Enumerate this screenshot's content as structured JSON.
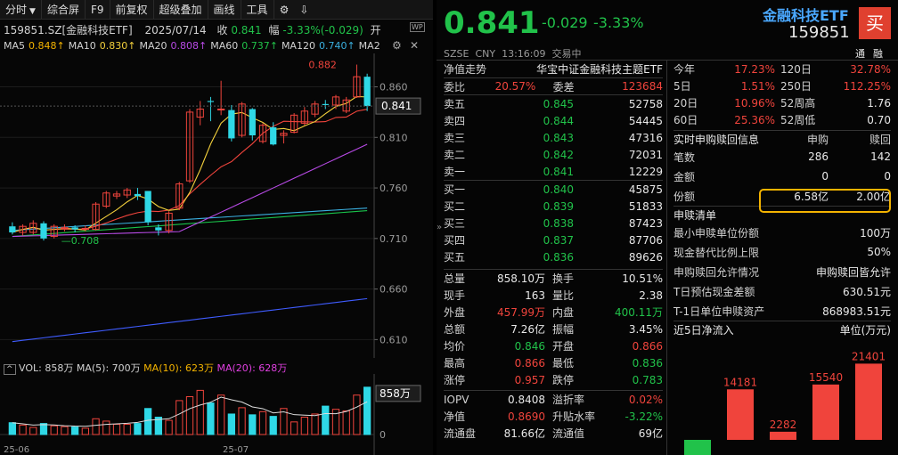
{
  "toolbar": {
    "period": "分时",
    "tabs": [
      "综合屏",
      "F9",
      "前复权",
      "超级叠加",
      "画线",
      "工具"
    ]
  },
  "info": {
    "code_name": "159851.SZ[金融科技ETF]",
    "date": "2025/07/14",
    "close_label": "收",
    "close": "0.841",
    "change_label": "幅",
    "change": "-3.33%(-0.029)",
    "open_label": "开"
  },
  "ma": {
    "ma5_label": "MA5",
    "ma5": "0.848↑",
    "ma10_label": "MA10",
    "ma10": "0.830↑",
    "ma20_label": "MA20",
    "ma20": "0.808↑",
    "ma60_label": "MA60",
    "ma60": "0.737↑",
    "ma120_label": "MA120",
    "ma120": "0.740↑",
    "ma2_label": "MA2"
  },
  "kline": {
    "max_label": "0.882",
    "min_label": "0.708",
    "price_axis": [
      "0.860",
      "0.810",
      "0.760",
      "0.710",
      "0.660",
      "0.610"
    ],
    "current": "0.841",
    "date_ticks": [
      "25-06",
      "25-07"
    ],
    "candles": [
      {
        "o": 0.722,
        "c": 0.716,
        "h": 0.726,
        "l": 0.714
      },
      {
        "o": 0.716,
        "c": 0.722,
        "h": 0.724,
        "l": 0.713
      },
      {
        "o": 0.716,
        "c": 0.725,
        "h": 0.728,
        "l": 0.714
      },
      {
        "o": 0.725,
        "c": 0.71,
        "h": 0.727,
        "l": 0.708
      },
      {
        "o": 0.712,
        "c": 0.722,
        "h": 0.724,
        "l": 0.71
      },
      {
        "o": 0.72,
        "c": 0.721,
        "h": 0.724,
        "l": 0.717
      },
      {
        "o": 0.721,
        "c": 0.719,
        "h": 0.723,
        "l": 0.716
      },
      {
        "o": 0.719,
        "c": 0.72,
        "h": 0.723,
        "l": 0.717
      },
      {
        "o": 0.719,
        "c": 0.744,
        "h": 0.746,
        "l": 0.718
      },
      {
        "o": 0.742,
        "c": 0.755,
        "h": 0.757,
        "l": 0.74
      },
      {
        "o": 0.752,
        "c": 0.754,
        "h": 0.757,
        "l": 0.749
      },
      {
        "o": 0.753,
        "c": 0.758,
        "h": 0.76,
        "l": 0.75
      },
      {
        "o": 0.754,
        "c": 0.752,
        "h": 0.76,
        "l": 0.748
      },
      {
        "o": 0.757,
        "c": 0.726,
        "h": 0.757,
        "l": 0.723
      },
      {
        "o": 0.721,
        "c": 0.718,
        "h": 0.724,
        "l": 0.713
      },
      {
        "o": 0.718,
        "c": 0.735,
        "h": 0.737,
        "l": 0.715
      },
      {
        "o": 0.74,
        "c": 0.764,
        "h": 0.766,
        "l": 0.738
      },
      {
        "o": 0.767,
        "c": 0.835,
        "h": 0.838,
        "l": 0.765
      },
      {
        "o": 0.83,
        "c": 0.838,
        "h": 0.846,
        "l": 0.822
      },
      {
        "o": 0.846,
        "c": 0.845,
        "h": 0.85,
        "l": 0.826
      },
      {
        "o": 0.838,
        "c": 0.838,
        "h": 0.866,
        "l": 0.832
      },
      {
        "o": 0.837,
        "c": 0.809,
        "h": 0.842,
        "l": 0.806
      },
      {
        "o": 0.812,
        "c": 0.843,
        "h": 0.845,
        "l": 0.81
      },
      {
        "o": 0.838,
        "c": 0.812,
        "h": 0.839,
        "l": 0.807
      },
      {
        "o": 0.806,
        "c": 0.822,
        "h": 0.824,
        "l": 0.804
      },
      {
        "o": 0.82,
        "c": 0.803,
        "h": 0.825,
        "l": 0.802
      },
      {
        "o": 0.812,
        "c": 0.814,
        "h": 0.817,
        "l": 0.804
      },
      {
        "o": 0.815,
        "c": 0.832,
        "h": 0.834,
        "l": 0.814
      },
      {
        "o": 0.824,
        "c": 0.836,
        "h": 0.84,
        "l": 0.822
      },
      {
        "o": 0.833,
        "c": 0.843,
        "h": 0.846,
        "l": 0.83
      },
      {
        "o": 0.843,
        "c": 0.842,
        "h": 0.847,
        "l": 0.838
      },
      {
        "o": 0.842,
        "c": 0.85,
        "h": 0.852,
        "l": 0.838
      },
      {
        "o": 0.836,
        "c": 0.847,
        "h": 0.85,
        "l": 0.834
      },
      {
        "o": 0.85,
        "c": 0.87,
        "h": 0.882,
        "l": 0.849
      },
      {
        "o": 0.87,
        "c": 0.841,
        "h": 0.873,
        "l": 0.836
      }
    ],
    "ma_lines": {
      "ma5_color": "#f3d03c",
      "ma10_color": "#f0443c",
      "ma20_color": "#b84ae6",
      "ma60_color": "#19c24a",
      "ma120_color": "#3ab0e0",
      "ma250_color": "#3f5cff"
    }
  },
  "vol": {
    "label": "VOL: 858万",
    "ma5": "MA(5): 700万",
    "ma10": "MA(10): 623万",
    "ma20": "MA(20): 628万",
    "current": "858万",
    "zero": "0",
    "bars": [
      150,
      120,
      90,
      140,
      110,
      100,
      95,
      80,
      200,
      170,
      130,
      130,
      140,
      330,
      220,
      180,
      430,
      480,
      560,
      400,
      500,
      260,
      340,
      250,
      290,
      230,
      330,
      160,
      220,
      260,
      360,
      320,
      300,
      500,
      600
    ]
  },
  "quote": {
    "price": "0.841",
    "change": "-0.029",
    "pct": "-3.33%",
    "name": "金融科技ETF",
    "code": "159851",
    "buy_btn": "买",
    "meta": "SZSE  CNY  13:16:09  交易中",
    "tong": "通",
    "rong": "融"
  },
  "index": {
    "label": "净值走势",
    "name": "华宝中证金融科技主题ETF"
  },
  "weibi": {
    "l1": "委比",
    "v1": "20.57%",
    "l2": "委差",
    "v2": "123684"
  },
  "asks": [
    {
      "l": "卖五",
      "p": "0.845",
      "v": "52758"
    },
    {
      "l": "卖四",
      "p": "0.844",
      "v": "54445"
    },
    {
      "l": "卖三",
      "p": "0.843",
      "v": "47316"
    },
    {
      "l": "卖二",
      "p": "0.842",
      "v": "72031"
    },
    {
      "l": "卖一",
      "p": "0.841",
      "v": "12229"
    }
  ],
  "bids": [
    {
      "l": "买一",
      "p": "0.840",
      "v": "45875"
    },
    {
      "l": "买二",
      "p": "0.839",
      "v": "51833"
    },
    {
      "l": "买三",
      "p": "0.838",
      "v": "87423"
    },
    {
      "l": "买四",
      "p": "0.837",
      "v": "87706"
    },
    {
      "l": "买五",
      "p": "0.836",
      "v": "89626"
    }
  ],
  "stats": [
    {
      "l1": "总量",
      "v1": "858.10万",
      "l2": "换手",
      "v2": "10.51%",
      "c1": "white",
      "c2": "white"
    },
    {
      "l1": "现手",
      "v1": "163",
      "l2": "量比",
      "v2": "2.38",
      "c1": "white",
      "c2": "white"
    },
    {
      "l1": "外盘",
      "v1": "457.99万",
      "l2": "内盘",
      "v2": "400.11万",
      "c1": "red",
      "c2": "green"
    },
    {
      "l1": "总额",
      "v1": "7.26亿",
      "l2": "振幅",
      "v2": "3.45%",
      "c1": "white",
      "c2": "white"
    },
    {
      "l1": "均价",
      "v1": "0.846",
      "l2": "开盘",
      "v2": "0.866",
      "c1": "green",
      "c2": "red"
    },
    {
      "l1": "最高",
      "v1": "0.866",
      "l2": "最低",
      "v2": "0.836",
      "c1": "red",
      "c2": "green"
    },
    {
      "l1": "涨停",
      "v1": "0.957",
      "l2": "跌停",
      "v2": "0.783",
      "c1": "red",
      "c2": "green"
    }
  ],
  "iopv": [
    {
      "l1": "IOPV",
      "v1": "0.8408",
      "l2": "溢折率",
      "v2": "0.02%",
      "c1": "white",
      "c2": "red"
    },
    {
      "l1": "净值",
      "v1": "0.8690",
      "l2": "升贴水率",
      "v2": "-3.22%",
      "c1": "red",
      "c2": "green"
    },
    {
      "l1": "流通盘",
      "v1": "81.66亿",
      "l2": "流通值",
      "v2": "69亿",
      "c1": "white",
      "c2": "white"
    }
  ],
  "perf": [
    {
      "l1": "今年",
      "v1": "17.23%",
      "l2": "120日",
      "v2": "32.78%"
    },
    {
      "l1": "5日",
      "v1": "1.51%",
      "l2": "250日",
      "v2": "112.25%"
    },
    {
      "l1": "20日",
      "v1": "10.96%",
      "l2": "52周高",
      "v2": "1.76"
    },
    {
      "l1": "60日",
      "v1": "25.36%",
      "l2": "52周低",
      "v2": "0.70"
    }
  ],
  "sg": {
    "title": "实时申购赎回信息",
    "col1": "申购",
    "col2": "赎回",
    "rows": [
      {
        "l": "笔数",
        "a": "286",
        "b": "142"
      },
      {
        "l": "金额",
        "a": "0",
        "b": "0"
      },
      {
        "l": "份额",
        "a": "6.58亿",
        "b": "2.00亿"
      }
    ]
  },
  "sgq": {
    "title": "申赎清单",
    "rows": [
      {
        "l": "最小申赎单位份额",
        "v": "100万"
      },
      {
        "l": "现金替代比例上限",
        "v": "50%"
      },
      {
        "l": "申购赎回允许情况",
        "v": "申购赎回皆允许"
      },
      {
        "l": "T日预估现金差额",
        "v": "630.51元"
      },
      {
        "l": "T-1日单位申赎资产",
        "v": "868983.51元"
      }
    ]
  },
  "flow": {
    "title": "近5日净流入",
    "unit": "单位(万元)",
    "values": [
      -6000,
      14181,
      2282,
      15540,
      21401
    ],
    "labels": [
      "",
      "14181",
      "2282",
      "15540",
      "21401"
    ]
  }
}
